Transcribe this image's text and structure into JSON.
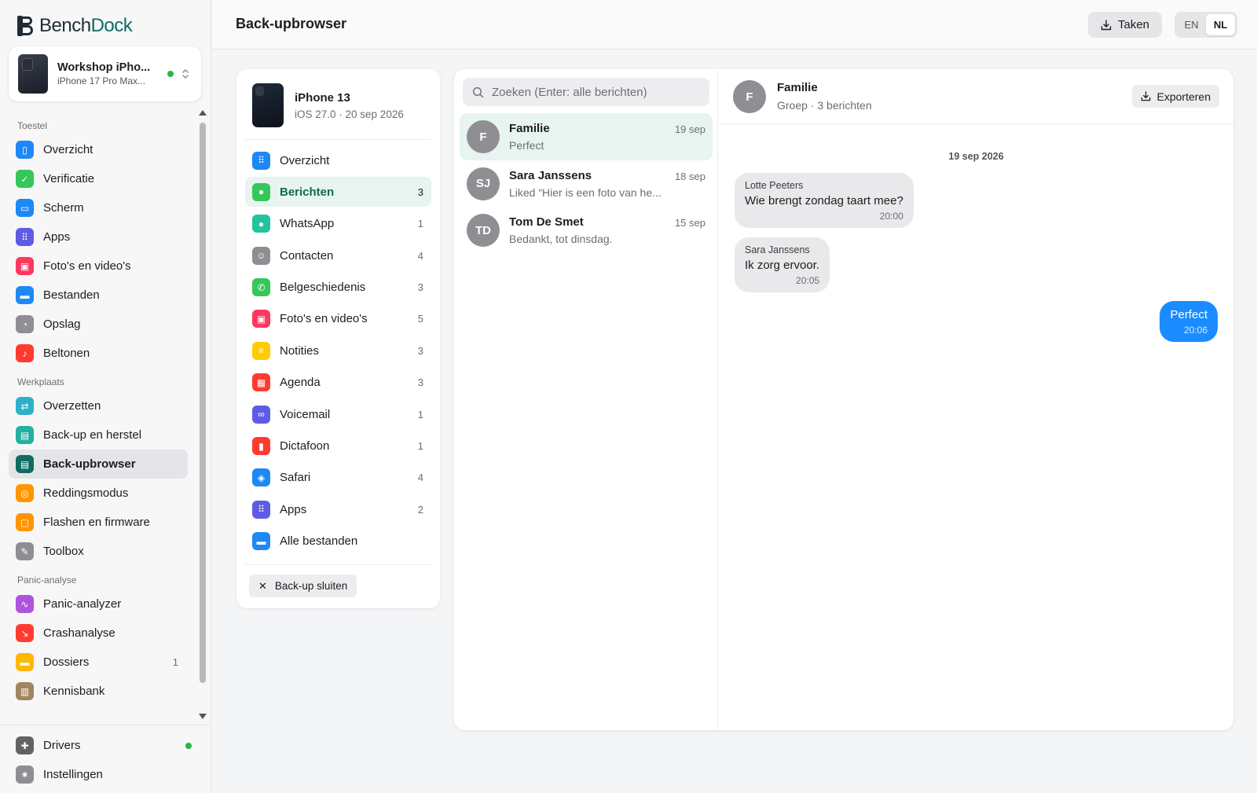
{
  "app": {
    "brand_part1": "Bench",
    "brand_part2": "Dock"
  },
  "device": {
    "name": "Workshop iPho...",
    "model": "iPhone 17 Pro Max...",
    "status_color": "#2bb24c"
  },
  "sidebar": {
    "sections": [
      {
        "label": "Toestel",
        "items": [
          {
            "label": "Overzicht",
            "icon": "phone-icon",
            "color": "#1e88f5"
          },
          {
            "label": "Verificatie",
            "icon": "shield-check-icon",
            "color": "#34c759"
          },
          {
            "label": "Scherm",
            "icon": "screen-icon",
            "color": "#1e88f5"
          },
          {
            "label": "Apps",
            "icon": "apps-grid-icon",
            "color": "#5e5ce6"
          },
          {
            "label": "Foto's en video's",
            "icon": "photo-icon",
            "color": "#ff375f"
          },
          {
            "label": "Bestanden",
            "icon": "folder-icon",
            "color": "#1e88f5"
          },
          {
            "label": "Opslag",
            "icon": "pie-chart-icon",
            "color": "#8e8e93"
          },
          {
            "label": "Beltonen",
            "icon": "music-note-icon",
            "color": "#ff3b30"
          }
        ]
      },
      {
        "label": "Werkplaats",
        "items": [
          {
            "label": "Overzetten",
            "icon": "transfer-arrows-icon",
            "color": "#30b0c7"
          },
          {
            "label": "Back-up en herstel",
            "icon": "archive-icon",
            "color": "#20b2a0"
          },
          {
            "label": "Back-upbrowser",
            "icon": "archive-browser-icon",
            "color": "#0e6b63",
            "active": true
          },
          {
            "label": "Reddingsmodus",
            "icon": "lifebuoy-icon",
            "color": "#ff9500"
          },
          {
            "label": "Flashen en firmware",
            "icon": "chip-icon",
            "color": "#ff9500"
          },
          {
            "label": "Toolbox",
            "icon": "wrench-icon",
            "color": "#8e8e93"
          }
        ]
      },
      {
        "label": "Panic-analyse",
        "items": [
          {
            "label": "Panic-analyzer",
            "icon": "waveform-icon",
            "color": "#af52de"
          },
          {
            "label": "Crashanalyse",
            "icon": "chart-down-icon",
            "color": "#ff3b30"
          },
          {
            "label": "Dossiers",
            "icon": "folder-icon",
            "color": "#ffb800",
            "count": "1"
          },
          {
            "label": "Kennisbank",
            "icon": "book-icon",
            "color": "#a2845e"
          }
        ]
      }
    ],
    "bottom": [
      {
        "label": "Drivers",
        "icon": "puzzle-icon",
        "color": "#636366",
        "dot": true
      },
      {
        "label": "Instellingen",
        "icon": "gear-icon",
        "color": "#8e8e93"
      }
    ]
  },
  "header": {
    "title": "Back-upbrowser",
    "tasks_label": "Taken",
    "lang_en": "EN",
    "lang_nl": "NL"
  },
  "backup": {
    "device": "iPhone 13",
    "info": "iOS 27.0 · 20 sep 2026",
    "items": [
      {
        "label": "Overzicht",
        "icon": "apps-grid-icon",
        "color": "#1e88f5",
        "count": ""
      },
      {
        "label": "Berichten",
        "icon": "message-bubble-icon",
        "color": "#34c759",
        "count": "3",
        "active": true
      },
      {
        "label": "WhatsApp",
        "icon": "whatsapp-icon",
        "color": "#25c2a0",
        "count": "1"
      },
      {
        "label": "Contacten",
        "icon": "contacts-icon",
        "color": "#8e8e93",
        "count": "4"
      },
      {
        "label": "Belgeschiedenis",
        "icon": "phone-call-icon",
        "color": "#34c759",
        "count": "3"
      },
      {
        "label": "Foto's en video's",
        "icon": "photo-icon",
        "color": "#ff375f",
        "count": "5"
      },
      {
        "label": "Notities",
        "icon": "note-icon",
        "color": "#ffcc00",
        "count": "3"
      },
      {
        "label": "Agenda",
        "icon": "calendar-icon",
        "color": "#ff3b30",
        "count": "3"
      },
      {
        "label": "Voicemail",
        "icon": "voicemail-icon",
        "color": "#5e5ce6",
        "count": "1"
      },
      {
        "label": "Dictafoon",
        "icon": "microphone-icon",
        "color": "#ff3b30",
        "count": "1"
      },
      {
        "label": "Safari",
        "icon": "compass-icon",
        "color": "#1e88f5",
        "count": "4"
      },
      {
        "label": "Apps",
        "icon": "apps-grid-icon",
        "color": "#5e5ce6",
        "count": "2"
      },
      {
        "label": "Alle bestanden",
        "icon": "folder-icon",
        "color": "#1e88f5",
        "count": ""
      }
    ],
    "close_label": "Back-up sluiten"
  },
  "messages": {
    "search_placeholder": "Zoeken (Enter: alle berichten)",
    "conversations": [
      {
        "initials": "F",
        "name": "Familie",
        "date": "19 sep",
        "preview": "Perfect",
        "active": true
      },
      {
        "initials": "SJ",
        "name": "Sara Janssens",
        "date": "18 sep",
        "preview": "Liked “Hier is een foto van he..."
      },
      {
        "initials": "TD",
        "name": "Tom De Smet",
        "date": "15 sep",
        "preview": "Bedankt, tot dinsdag."
      }
    ],
    "thread": {
      "initials": "F",
      "name": "Familie",
      "subtitle": "Groep · 3 berichten",
      "export_label": "Exporteren",
      "day": "19 sep 2026",
      "bubbles": [
        {
          "sender": "Lotte Peeters",
          "text": "Wie brengt zondag taart mee?",
          "time": "20:00"
        },
        {
          "sender": "Sara Janssens",
          "text": "Ik zorg ervoor.",
          "time": "20:05"
        },
        {
          "sender": "",
          "text": "Perfect",
          "time": "20:06",
          "outgoing": true
        }
      ]
    }
  }
}
